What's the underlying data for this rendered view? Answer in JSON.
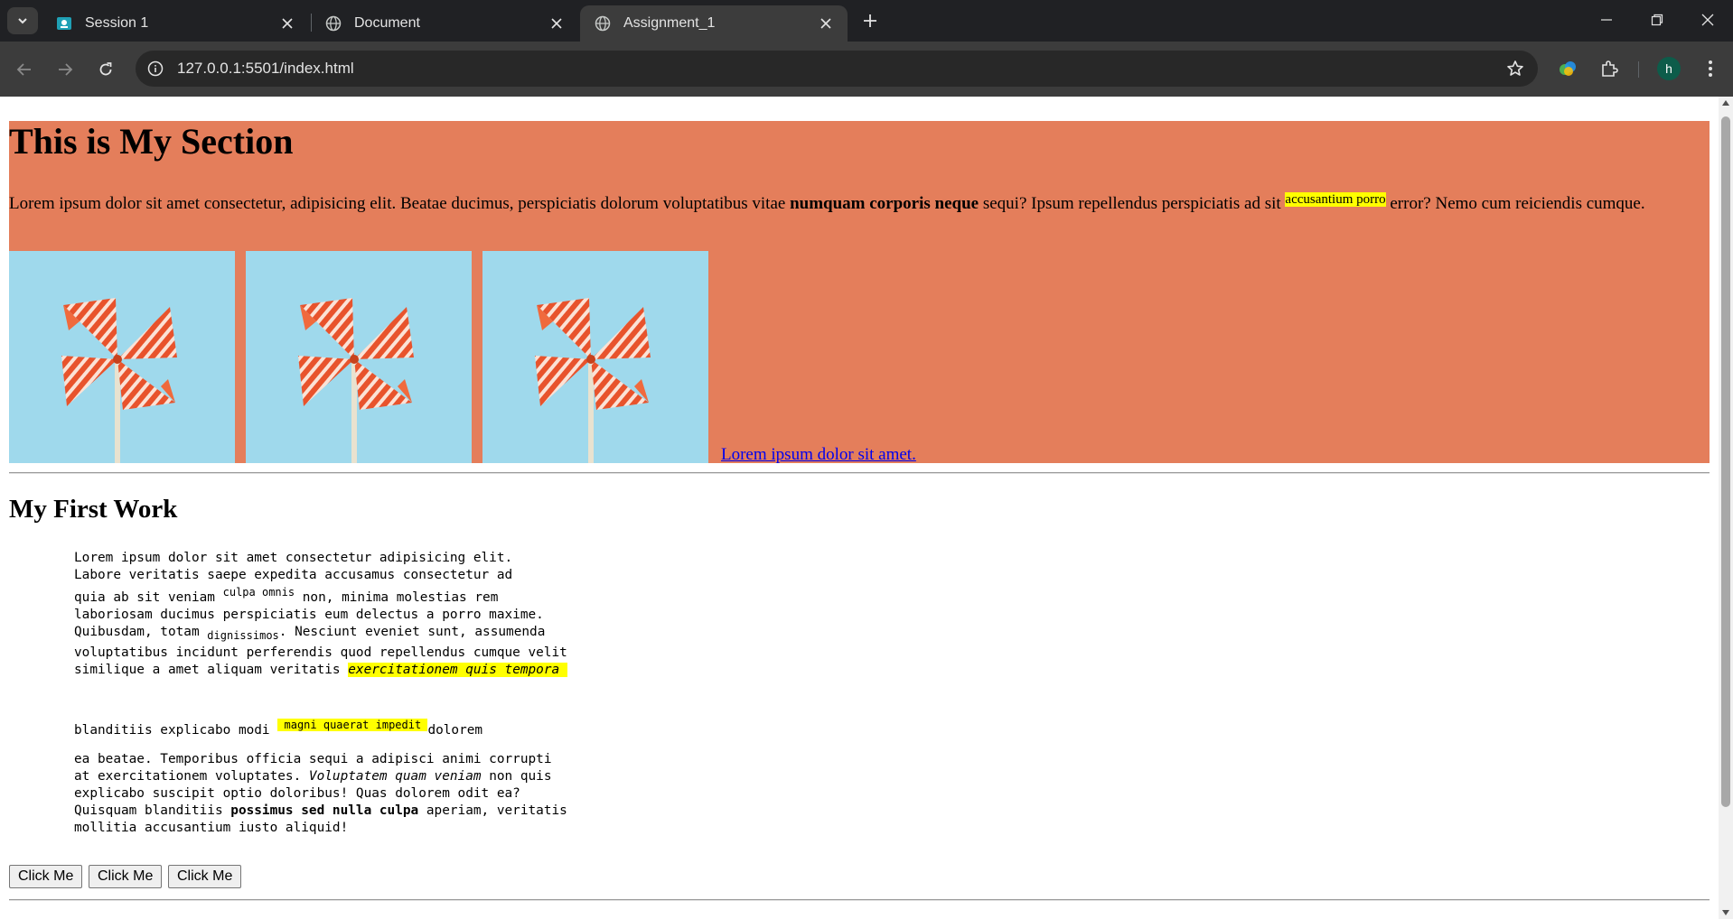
{
  "browser": {
    "tabs": [
      {
        "title": "Session 1",
        "active": false
      },
      {
        "title": "Document",
        "active": false
      },
      {
        "title": "Assignment_1",
        "active": true
      }
    ],
    "url": "127.0.0.1:5501/index.html",
    "profile_initial": "h"
  },
  "section": {
    "heading": "This is My Section",
    "para_a": "Lorem ipsum dolor sit amet consectetur, adipisicing elit. Beatae ducimus, perspiciatis dolorum voluptatibus vitae ",
    "para_bold": "numquam corporis neque",
    "para_b": " sequi? Ipsum repellendus perspiciatis ad sit ",
    "para_highlight": "accusantium porro",
    "para_c": " error? Nemo cum reiciendis cumque.",
    "link_text": "Lorem ipsum dolor sit amet."
  },
  "work": {
    "heading": "My First Work",
    "block1": {
      "l1": "Lorem ipsum dolor sit amet consectetur adipisicing elit.",
      "l2": "Labore veritatis saepe expedita accusamus consectetur ad",
      "l3a": "quia ab sit veniam ",
      "l3sup": "culpa omnis",
      "l3b": " non, minima molestias rem",
      "l4": "laboriosam ducimus perspiciatis eum delectus a porro maxime.",
      "l5a": "Quibusdam, totam ",
      "l5sub": "dignissimos",
      "l5b": ". Nesciunt eveniet sunt, assumenda",
      "l6": "voluptatibus incidunt perferendis quod repellendus cumque velit",
      "l7a": "similique a amet aliquam veritatis ",
      "l7hl": "exercitationem quis tempora "
    },
    "block2": {
      "a": "blanditiis explicabo modi ",
      "hl": " magni quaerat impedit ",
      "b": "dolorem"
    },
    "block3": {
      "l1": "ea beatae. Temporibus officia sequi a adipisci animi corrupti",
      "l2a": "at exercitationem voluptates. ",
      "l2i": "Voluptatem quam veniam",
      "l2b": " non quis",
      "l3": "explicabo suscipit optio doloribus! Quas dolorem odit ea?",
      "l4a": "Quisquam blanditiis ",
      "l4b": "possimus sed nulla culpa",
      "l4c": " aperiam, veritatis",
      "l5": "mollitia accusantium iusto aliquid!"
    },
    "buttons": [
      "Click Me",
      "Click Me",
      "Click Me"
    ]
  }
}
